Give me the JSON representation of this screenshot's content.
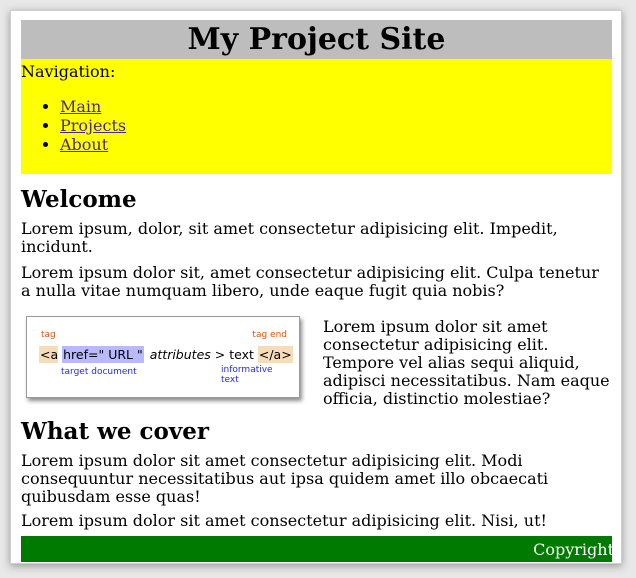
{
  "header": {
    "title": "My Project Site"
  },
  "nav": {
    "label": "Navigation:",
    "links": [
      "Main",
      "Projects",
      "About"
    ]
  },
  "welcome": {
    "heading": "Welcome",
    "p1": "Lorem ipsum, dolor, sit amet consectetur adipisicing elit. Impedit, incidunt.",
    "p2": "Lorem ipsum dolor sit, amet consectetur adipisicing elit. Culpa tenetur a nulla vitae numquam libero, unde eaque fugit quia nobis?"
  },
  "diagram": {
    "tag_label": "tag",
    "tag_end_label": "tag end",
    "open_tag": "<a",
    "href": "href=\" URL \"",
    "attributes": "attributes",
    "gt_text": "> text",
    "close_tag": "</a>",
    "target_label": "target document",
    "info_label": "informative text",
    "colors": {
      "tag": "#e0560b",
      "label": "#2a2adf",
      "tag_bg": "#f7dcb8",
      "href_bg": "#b9b9ff"
    }
  },
  "side_text": "Lorem ipsum dolor sit amet consectetur adipisicing elit. Tempore vel alias sequi aliquid, adipisci necessitatibus. Nam eaque officia, distinctio molestiae?",
  "cover": {
    "heading": "What we cover",
    "p1": "Lorem ipsum dolor sit amet consectetur adipisicing elit. Modi consequuntur necessitatibus aut ipsa quidem amet illo obcaecati quibusdam esse quas!",
    "p2": "Lorem ipsum dolor sit amet consectetur adipisicing elit. Nisi, ut!"
  },
  "footer": {
    "text": "Copyright"
  },
  "colors": {
    "header_bg": "#bdbdbd",
    "nav_bg": "#ffff00",
    "footer_bg": "#007a00",
    "link": "#4a2a86"
  }
}
